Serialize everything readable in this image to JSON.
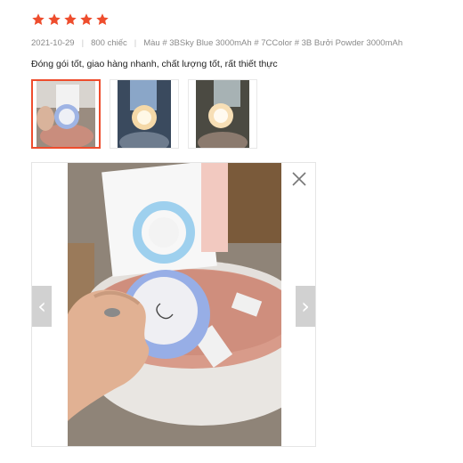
{
  "review": {
    "rating": 5,
    "rating_max": 5,
    "star_color": "#ee4d2d",
    "date": "2021-10-29",
    "quantity": "800 chiếc",
    "variant": "Màu # 3BSky Blue 3000mAh # 7CColor # 3B Bưởi Powder 3000mAh",
    "comment": "Đóng gói tốt, giao hàng nhanh, chất lượng tốt, rất thiết thực"
  },
  "media": {
    "thumbnails": [
      {
        "name": "thumbnail-1",
        "active": true
      },
      {
        "name": "thumbnail-2",
        "active": false
      },
      {
        "name": "thumbnail-3",
        "active": false
      }
    ],
    "viewer": {
      "prev_icon": "chevron-left-icon",
      "next_icon": "chevron-right-icon",
      "close_icon": "close-icon",
      "prev_glyph": "‹",
      "next_glyph": "›"
    },
    "accent_color": "#ee4d2d"
  }
}
